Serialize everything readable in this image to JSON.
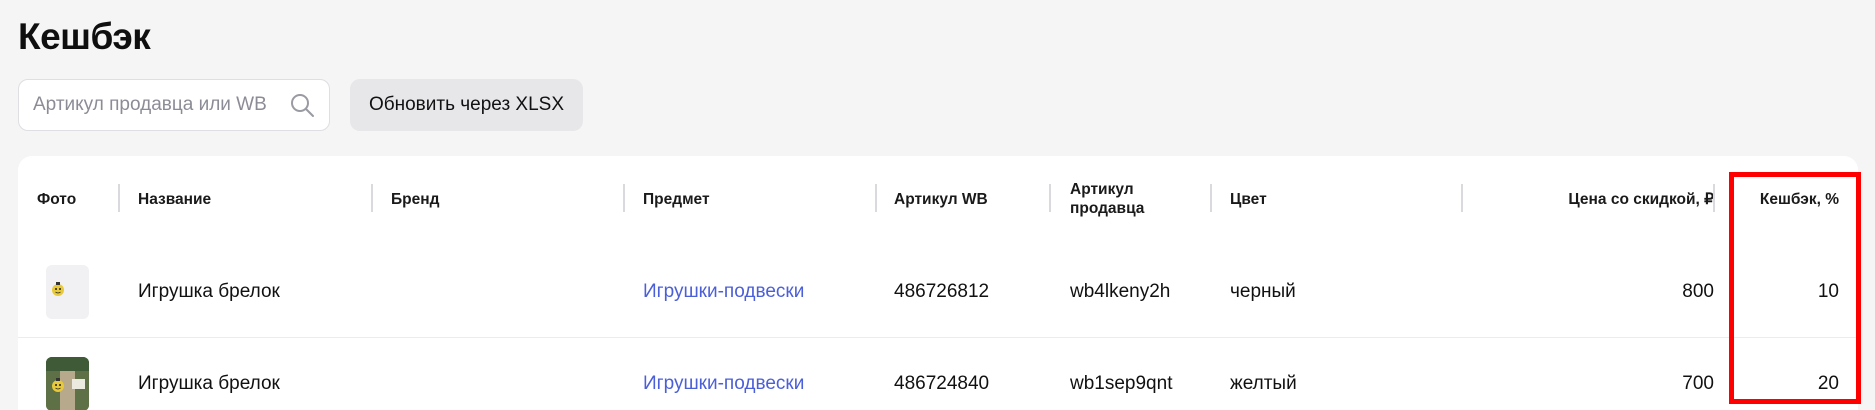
{
  "page": {
    "title": "Кешбэк"
  },
  "toolbar": {
    "search_placeholder": "Артикул продавца или WB",
    "update_label": "Обновить через XLSX"
  },
  "table": {
    "headers": {
      "photo": "Фото",
      "name": "Название",
      "brand": "Бренд",
      "subject": "Предмет",
      "article_wb": "Артикул WB",
      "article_seller_line1": "Артикул",
      "article_seller_line2": "продавца",
      "color": "Цвет",
      "price": "Цена со скидкой, ₽",
      "cashback": "Кешбэк, %"
    },
    "rows": [
      {
        "name": "Игрушка брелок",
        "brand": "",
        "subject": "Игрушки-подвески",
        "article_wb": "486726812",
        "article_seller": "wb4lkeny2h",
        "color": "черный",
        "price": "800",
        "cashback": "10"
      },
      {
        "name": "Игрушка брелок",
        "brand": "",
        "subject": "Игрушки-подвески",
        "article_wb": "486724840",
        "article_seller": "wb1sep9qnt",
        "color": "желтый",
        "price": "700",
        "cashback": "20"
      }
    ]
  },
  "colors": {
    "accent_link": "#4b5fd8",
    "highlight": "#ff0000",
    "background": "#f5f5f6"
  },
  "icons": {
    "search": "search-icon",
    "product_photo": "product-photo"
  }
}
